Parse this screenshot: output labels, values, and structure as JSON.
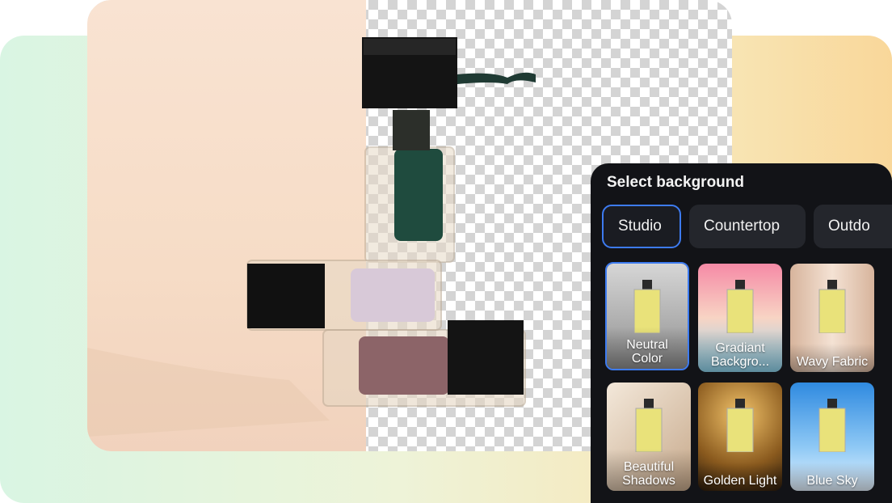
{
  "panel": {
    "title": "Select background",
    "tabs": [
      {
        "label": "Studio",
        "active": true
      },
      {
        "label": "Countertop",
        "active": false
      },
      {
        "label": "Outdo",
        "active": false
      }
    ],
    "options": [
      {
        "label": "Neutral Color",
        "selected": true,
        "colors": [
          "#c8c8c8",
          "#8e8e8e"
        ]
      },
      {
        "label": "Gradiant Backgro...",
        "selected": false,
        "colors": [
          "#f58aa6",
          "#8fd6f0"
        ]
      },
      {
        "label": "Wavy Fabric",
        "selected": false,
        "colors": [
          "#f1d6c4",
          "#d7b49c"
        ]
      },
      {
        "label": "Beautiful Shadows",
        "selected": false,
        "colors": [
          "#efe3d3",
          "#c7a98b"
        ]
      },
      {
        "label": "Golden Light",
        "selected": false,
        "colors": [
          "#3a2410",
          "#c78a2e"
        ]
      },
      {
        "label": "Blue Sky",
        "selected": false,
        "colors": [
          "#2f8ae0",
          "#bfe3ff"
        ]
      }
    ]
  },
  "colors": {
    "panel_bg": "#121317",
    "accent": "#3d7bf0"
  }
}
